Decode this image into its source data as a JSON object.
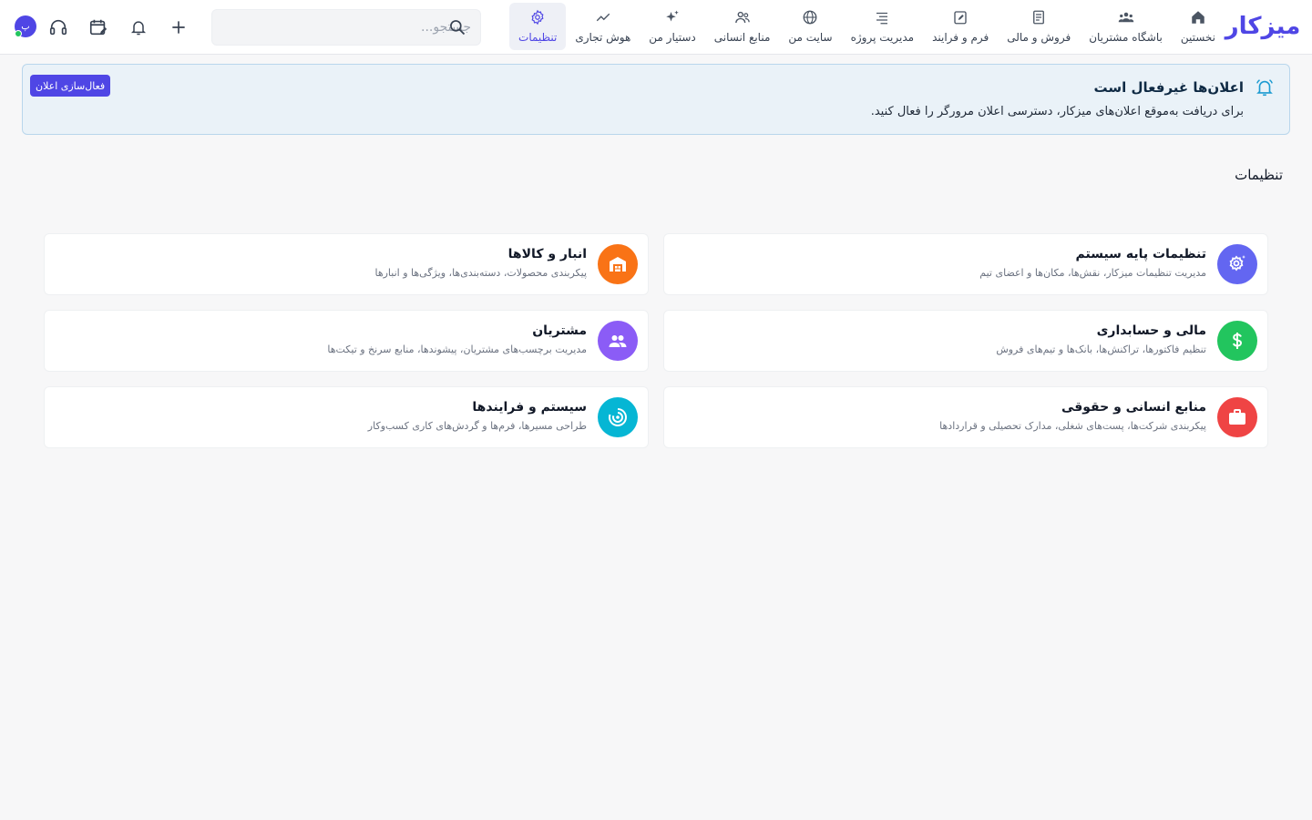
{
  "app": {
    "logo_text": "میزکار",
    "brand_color": "#4f46e5"
  },
  "nav": [
    {
      "key": "home",
      "label": "نخستین",
      "icon": "home-icon"
    },
    {
      "key": "club",
      "label": "باشگاه مشتریان",
      "icon": "users-group-icon"
    },
    {
      "key": "sales",
      "label": "فروش و مالی",
      "icon": "receipt-icon"
    },
    {
      "key": "forms",
      "label": "فرم و فرایند",
      "icon": "clipboard-edit-icon"
    },
    {
      "key": "projects",
      "label": "مدیریت پروژه",
      "icon": "list-lines-icon"
    },
    {
      "key": "site",
      "label": "سایت من",
      "icon": "globe-icon"
    },
    {
      "key": "hr",
      "label": "منابع انسانی",
      "icon": "people-icon"
    },
    {
      "key": "assistant",
      "label": "دستیار من",
      "icon": "sparkles-icon"
    },
    {
      "key": "bi",
      "label": "هوش تجاری",
      "icon": "trend-line-icon"
    },
    {
      "key": "settings",
      "label": "تنظیمات",
      "icon": "gear-icon",
      "active": true
    }
  ],
  "search": {
    "placeholder": "جستجو..."
  },
  "tools": [
    "add-icon",
    "bell-icon",
    "calendar-edit-icon",
    "headset-icon"
  ],
  "avatar": {
    "initials": "پ",
    "status_color": "#22c55e"
  },
  "alert": {
    "title": "اعلان‌ها غیرفعال است",
    "description": "برای دریافت به‌موقع اعلان‌های میزکار، دسترسی اعلان مرورگر را فعال کنید.",
    "button_label": "فعال‌سازی اعلان"
  },
  "page": {
    "title": "تنظیمات"
  },
  "cards": [
    {
      "title": "تنظیمات پایه سیستم",
      "description": "مدیریت تنظیمات میزکار، نقش‌ها، مکان‌ها و اعضای تیم",
      "icon": "gear-sparkle-icon",
      "color": "#6366f1"
    },
    {
      "title": "انبار و کالاها",
      "description": "پیکربندی محصولات، دسته‌بندی‌ها، ویژگی‌ها و انبارها",
      "icon": "warehouse-icon",
      "color": "#f97316"
    },
    {
      "title": "مالی و حسابداری",
      "description": "تنظیم فاکتورها، تراکنش‌ها، بانک‌ها و تیم‌های فروش",
      "icon": "dollar-icon",
      "color": "#22c55e"
    },
    {
      "title": "مشتریان",
      "description": "مدیریت برچسب‌های مشتریان، پیشوندها، منابع سرنخ و تیکت‌ها",
      "icon": "customers-icon",
      "color": "#8b5cf6"
    },
    {
      "title": "منابع انسانی و حقوقی",
      "description": "پیکربندی شرکت‌ها، پست‌های شغلی، مدارک تحصیلی و قراردادها",
      "icon": "briefcase-icon",
      "color": "#ef4444"
    },
    {
      "title": "سیستم و فرایندها",
      "description": "طراحی مسیرها، فرم‌ها و گردش‌های کاری کسب‌وکار",
      "icon": "target-icon",
      "color": "#06b6d4"
    }
  ]
}
